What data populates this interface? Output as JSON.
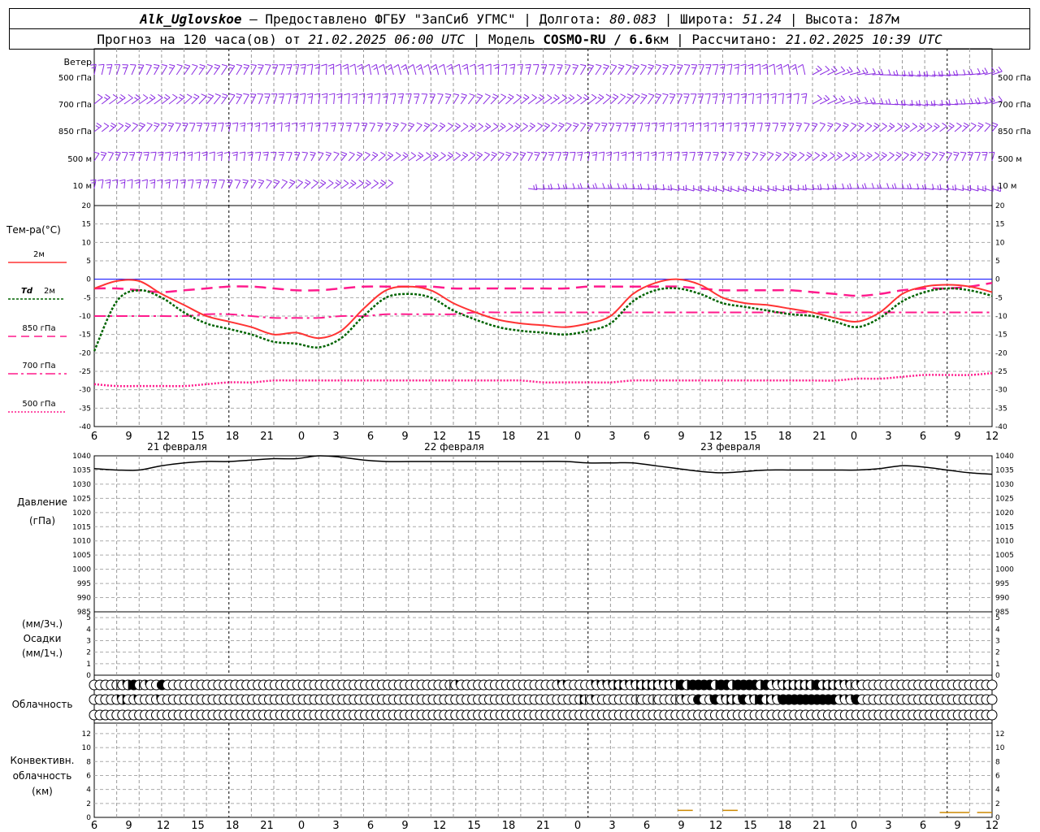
{
  "header": {
    "station": "Alk_Uglovskoe",
    "provider": " – Предоставлено ФГБУ \"ЗапСиб УГМС\" | Долгота: ",
    "lon": "80.083",
    "lat_label": " | Широта: ",
    "lat": "51.24",
    "alt_label": " | Высота: ",
    "alt": "187",
    "alt_unit": "м",
    "forecast_label": "Прогноз на 120 часа(ов) от ",
    "forecast_start": "21.02.2025 06:00 UTC",
    "model_label": " | Модель ",
    "model": "COSMO-RU / 6.6",
    "model_unit": "км",
    "calc_label": " | Рассчитано: ",
    "calc_time": "21.02.2025 10:39 UTC"
  },
  "labels": {
    "wind": "Ветер",
    "wind_levels": [
      "500 гПа",
      "700 гПа",
      "850 гПа",
      "500 м",
      "10 м"
    ],
    "temp": "Тем-ра(°С)",
    "t2m": "2м",
    "td_a": "Td",
    "td_b": "2м",
    "t850": "850 гПа",
    "t700": "700 гПа",
    "t500": "500 гПа",
    "pressure": "Давление",
    "pressure_unit": "(гПа)",
    "precip_unit1": "(мм/3ч.)",
    "precip": "Осадки",
    "precip_unit2": "(мм/1ч.)",
    "cloud": "Облачность",
    "conv1": "Конвективн.",
    "conv2": "облачность",
    "conv3": "(км)"
  },
  "colors": {
    "wind": "#8a2be2",
    "t2m": "#ff3333",
    "td": "#006400",
    "levels": "#ff1a8c",
    "freeze": "#0000ff",
    "pressure": "#000000",
    "conv": "#cc8800"
  },
  "chart_data": [
    {
      "type": "line",
      "title": "Тем-ра(°С)",
      "x_hours": [
        0,
        3,
        6,
        9,
        12,
        15,
        18,
        21,
        24,
        27,
        30,
        33,
        36,
        39,
        42,
        45,
        48,
        51,
        54,
        57,
        60,
        63,
        66,
        69,
        72,
        75,
        78,
        81,
        84,
        87,
        90,
        93,
        96,
        99,
        102,
        105,
        108,
        111,
        114,
        117,
        120
      ],
      "ylim": [
        -40,
        20
      ],
      "series": [
        {
          "name": "2м",
          "values": [
            -2.5,
            -0.5,
            -0.5,
            -4,
            -7,
            -10,
            -11.5,
            -13,
            -15,
            -14.5,
            -16,
            -14,
            -8,
            -3,
            -2,
            -3,
            -6.5,
            -9,
            -11,
            -12,
            -12.5,
            -13,
            -12,
            -10,
            -4,
            -1,
            0,
            -1.5,
            -5,
            -6.5,
            -7,
            -8,
            -9,
            -10.5,
            -11.5,
            -9,
            -4,
            -2,
            -1.5,
            -2,
            -3.5
          ]
        },
        {
          "name": "Td 2м",
          "values": [
            -19.5,
            -6,
            -3,
            -5,
            -9,
            -12,
            -13.5,
            -15,
            -17,
            -17.5,
            -18.5,
            -16,
            -10,
            -5,
            -4,
            -5,
            -8.5,
            -11,
            -13,
            -14,
            -14.5,
            -15,
            -14,
            -12,
            -6,
            -3,
            -2.5,
            -4,
            -6.5,
            -7.5,
            -8.5,
            -9.5,
            -10,
            -11.5,
            -13,
            -10.5,
            -6,
            -3.5,
            -2.5,
            -3,
            -4.5
          ]
        },
        {
          "name": "850 гПа",
          "values": [
            -2.5,
            -2.5,
            -3,
            -3.5,
            -3,
            -2.5,
            -2,
            -2,
            -2.5,
            -3,
            -3,
            -2.5,
            -2,
            -2,
            -2,
            -2,
            -2.5,
            -2.5,
            -2.5,
            -2.5,
            -2.5,
            -2.5,
            -2,
            -2,
            -2,
            -2,
            -2,
            -2.5,
            -3,
            -3,
            -3,
            -3,
            -3.5,
            -4,
            -4.5,
            -4,
            -3,
            -2.5,
            -2.5,
            -2,
            -1
          ]
        },
        {
          "name": "700 гПа",
          "values": [
            -10,
            -10,
            -10,
            -10,
            -10,
            -9.5,
            -9.5,
            -10,
            -10.5,
            -10.5,
            -10.5,
            -10,
            -10,
            -9.5,
            -9.5,
            -9.5,
            -9.5,
            -9,
            -9,
            -9,
            -9,
            -9,
            -9,
            -9,
            -9,
            -9,
            -9,
            -9,
            -9,
            -9,
            -9,
            -9,
            -9,
            -9,
            -9,
            -9,
            -9,
            -9,
            -9,
            -9,
            -9
          ]
        },
        {
          "name": "500 гПа",
          "values": [
            -28.5,
            -29,
            -29,
            -29,
            -29,
            -28.5,
            -28,
            -28,
            -27.5,
            -27.5,
            -27.5,
            -27.5,
            -27.5,
            -27.5,
            -27.5,
            -27.5,
            -27.5,
            -27.5,
            -27.5,
            -27.5,
            -28,
            -28,
            -28,
            -28,
            -27.5,
            -27.5,
            -27.5,
            -27.5,
            -27.5,
            -27.5,
            -27.5,
            -27.5,
            -27.5,
            -27.5,
            -27,
            -27,
            -26.5,
            -26,
            -26,
            -26,
            -25.5
          ]
        }
      ]
    },
    {
      "type": "line",
      "title": "Давление",
      "x_hours": [
        0,
        3,
        6,
        9,
        12,
        15,
        18,
        21,
        24,
        27,
        30,
        33,
        36,
        39,
        42,
        45,
        48,
        51,
        54,
        57,
        60,
        63,
        66,
        69,
        72,
        75,
        78,
        81,
        84,
        87,
        90,
        93,
        96,
        99,
        102,
        105,
        108,
        111,
        114,
        117,
        120
      ],
      "ylim": [
        985,
        1040
      ],
      "series": [
        {
          "name": "Давление",
          "values": [
            1035.5,
            1035,
            1035,
            1036.5,
            1037.5,
            1038,
            1038,
            1038.5,
            1039,
            1039,
            1040,
            1039.5,
            1038.5,
            1038,
            1038,
            1038,
            1038,
            1038,
            1038,
            1038,
            1038,
            1038,
            1037.5,
            1037.5,
            1037.5,
            1036.5,
            1035.5,
            1034.5,
            1034,
            1034.5,
            1035,
            1035,
            1035,
            1035,
            1035,
            1035.5,
            1036.5,
            1036,
            1035,
            1034,
            1033.5
          ]
        }
      ]
    },
    {
      "type": "bar",
      "title": "Конвективн. облачность",
      "ylim": [
        0,
        13
      ],
      "segments": [
        {
          "x0": 78,
          "x1": 80,
          "y": 1
        },
        {
          "x0": 84,
          "x1": 86,
          "y": 1
        },
        {
          "x0": 113,
          "x1": 117,
          "y": 0.7
        },
        {
          "x0": 118,
          "x1": 120,
          "y": 0.7
        }
      ]
    }
  ],
  "axes": {
    "hour_ticks": [
      "6",
      "9",
      "12",
      "15",
      "18",
      "21",
      "0",
      "3",
      "6",
      "9",
      "12",
      "15",
      "18",
      "21",
      "0",
      "3",
      "6",
      "9",
      "12",
      "15",
      "18",
      "21",
      "0",
      "3",
      "6",
      "9",
      "12"
    ],
    "day_labels": [
      "21 февраля",
      "22 февраля",
      "23 февраля"
    ],
    "temp_ticks": [
      "20",
      "15",
      "10",
      "5",
      "0",
      "-5",
      "-10",
      "-15",
      "-20",
      "-25",
      "-30",
      "-35",
      "-40"
    ],
    "pressure_ticks": [
      "1040",
      "1035",
      "1030",
      "1025",
      "1020",
      "1015",
      "1010",
      "1005",
      "1000",
      "995",
      "990",
      "985"
    ],
    "precip_ticks": [
      "5",
      "4",
      "3",
      "2",
      "1",
      "0"
    ],
    "conv_ticks": [
      "12",
      "10",
      "8",
      "6",
      "4",
      "2",
      "0"
    ]
  },
  "clouds": {
    "row1": "0000123412004000000000000000000000000000000000000000000000000001200000000000000000220000222233223333232343444434434444342233333343332212000000000000000000000000",
    "row2": "0000230200020000000000000000000000000000000000000000000000000000000000000000000000000031200000001001000120040242332423432244444444442224000000000000000000000000",
    "row3": "0000000000000000000000000000000000000000000000000000000000000000000000000000000000000000000000000000000000000000000000000000000000000000000000000000000000000000"
  }
}
